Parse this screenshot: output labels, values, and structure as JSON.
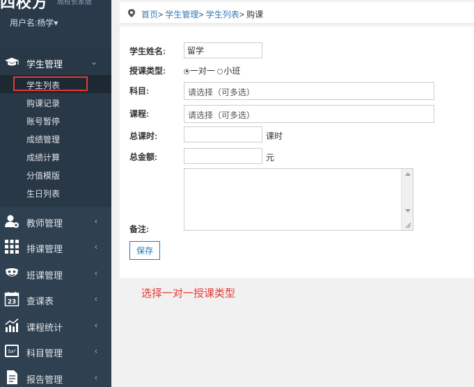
{
  "sidebar": {
    "logo_text": "四校方",
    "logo_small": "局校长家版",
    "username": "用户名:杨学▾",
    "student_menu": {
      "label": "学生管理",
      "arrow": "⌄",
      "items": [
        {
          "label": "学生列表"
        },
        {
          "label": "购课记录"
        },
        {
          "label": "账号暂停"
        },
        {
          "label": "成绩管理"
        },
        {
          "label": "成绩计算"
        },
        {
          "label": "分值模版"
        },
        {
          "label": "生日列表"
        }
      ]
    },
    "menus": [
      {
        "label": "教师管理",
        "icon": "teacher-icon",
        "arrow": "‹"
      },
      {
        "label": "排课管理",
        "icon": "grid-icon",
        "arrow": "‹"
      },
      {
        "label": "班课管理",
        "icon": "mask-icon",
        "arrow": "‹"
      },
      {
        "label": "查课表",
        "icon": "calendar-icon",
        "arrow": "‹",
        "calendar_day": "23"
      },
      {
        "label": "课程统计",
        "icon": "chart-icon",
        "arrow": "‹"
      },
      {
        "label": "科目管理",
        "icon": "formula-icon",
        "arrow": "‹",
        "formula": "Sx²"
      },
      {
        "label": "报告管理",
        "icon": "report-icon",
        "arrow": "‹"
      }
    ]
  },
  "breadcrumb": {
    "home": "首页",
    "sep": ">",
    "level1": "学生管理",
    "level2": "学生列表",
    "current": "购课"
  },
  "form": {
    "name_label": "学生姓名:",
    "name_value": "留学",
    "type_label": "授课类型:",
    "type_options": [
      {
        "label": "一对一",
        "checked": true
      },
      {
        "label": "小班",
        "checked": false
      }
    ],
    "subject_label": "科目:",
    "subject_placeholder": "请选择（可多选）",
    "course_label": "课程:",
    "course_placeholder": "请选择（可多选）",
    "hours_label": "总课时:",
    "hours_value": "",
    "hours_unit": "课时",
    "amount_label": "总金额:",
    "amount_value": "",
    "amount_unit": "元",
    "note_label": "备注:",
    "save_label": "保存"
  },
  "annotation": "选择一对一授课类型",
  "colors": {
    "sidebar_bg": "#2f4050",
    "link": "#337ab7",
    "button": "#1a7bb9",
    "highlight": "#e53935"
  }
}
